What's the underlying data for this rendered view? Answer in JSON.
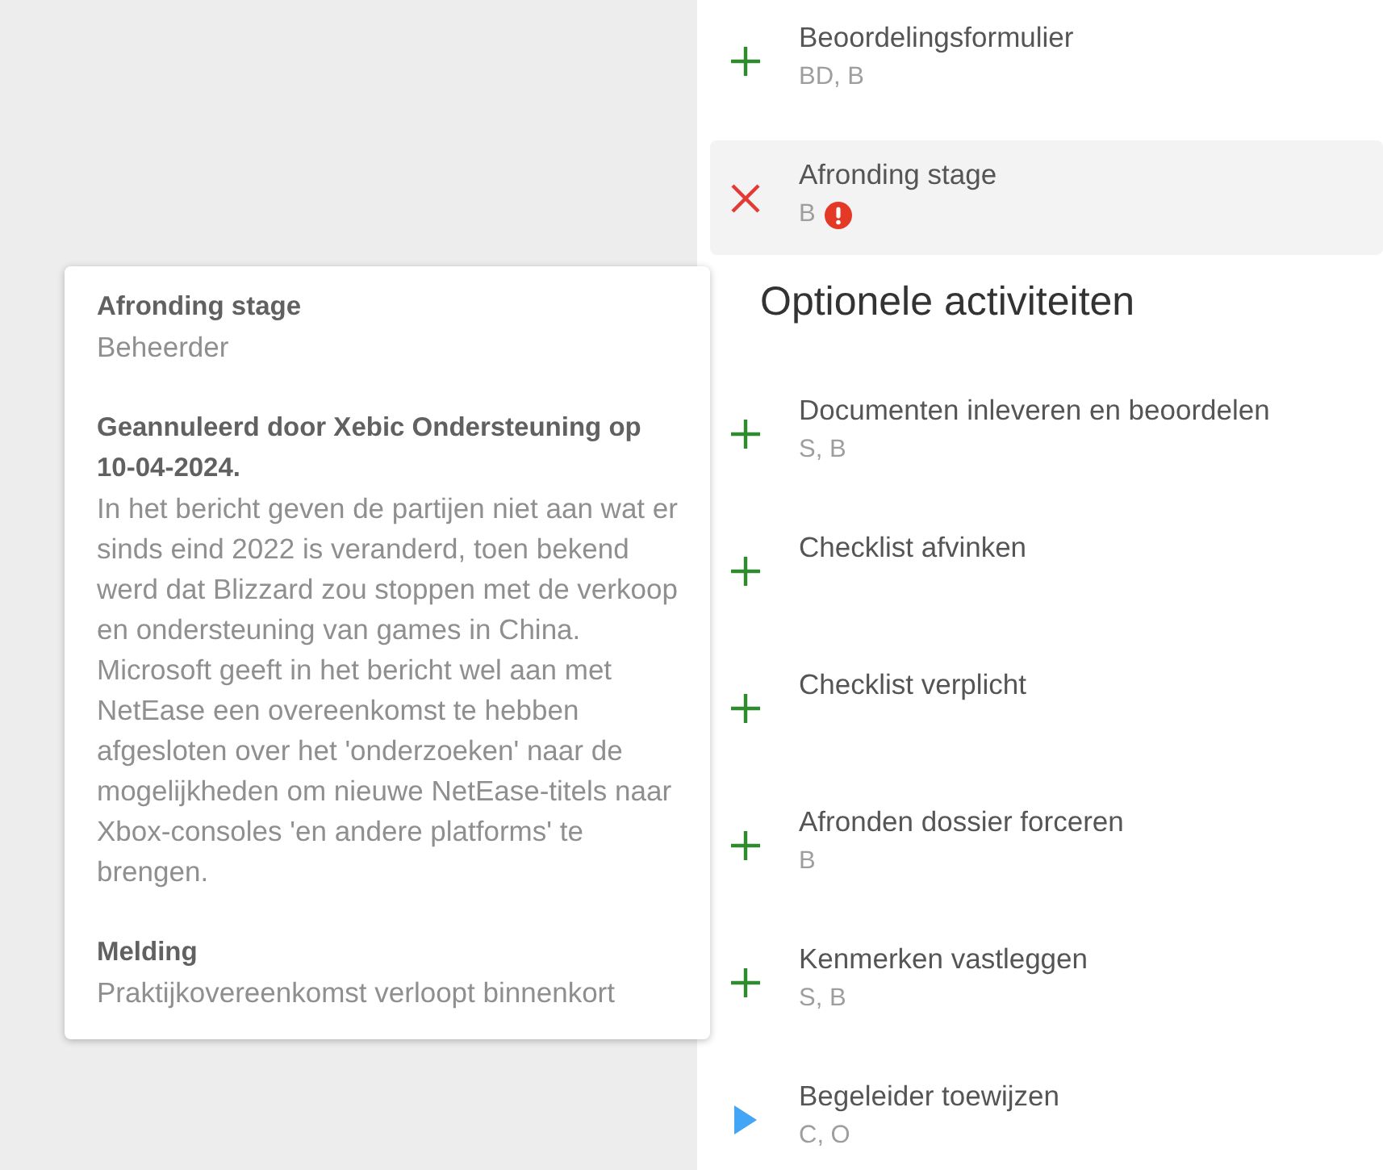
{
  "activities": [
    {
      "kind": "add",
      "title": "Beoordelingsformulier",
      "roles": "BD, B",
      "selected": false,
      "alert": false
    },
    {
      "kind": "cancelled",
      "title": "Afronding stage",
      "roles": "B",
      "selected": true,
      "alert": true
    }
  ],
  "optional_section": {
    "heading": "Optionele activiteiten",
    "activities": [
      {
        "kind": "add",
        "title": "Documenten inleveren en beoordelen",
        "roles": "S, B",
        "selected": false,
        "alert": false
      },
      {
        "kind": "add",
        "title": "Checklist afvinken",
        "selected": false,
        "alert": false
      },
      {
        "kind": "add",
        "title": "Checklist verplicht",
        "selected": false,
        "alert": false
      },
      {
        "kind": "add",
        "title": "Afronden dossier forceren",
        "roles": "B",
        "selected": false,
        "alert": false
      },
      {
        "kind": "add",
        "title": "Kenmerken vastleggen",
        "roles": "S, B",
        "selected": false,
        "alert": false
      },
      {
        "kind": "start",
        "title": "Begeleider toewijzen",
        "roles": "C, O",
        "selected": false,
        "alert": false
      }
    ]
  },
  "tooltip": {
    "title": "Afronding stage",
    "subtitle": "Beheerder",
    "sections": [
      {
        "heading": "Geannuleerd door Xebic Ondersteuning op 10-04-2024.",
        "text": "In het bericht geven de partijen niet aan wat er sinds eind 2022 is veranderd, toen bekend werd dat Blizzard zou stoppen met de verkoop en ondersteuning van games in China. Microsoft geeft in het bericht wel aan met NetEase een overeenkomst te hebben afgesloten over het 'onderzoeken' naar de mogelijkheden om nieuwe NetEase-titels naar Xbox-consoles 'en andere platforms' te brengen."
      },
      {
        "heading": "Melding",
        "text": "Praktijkovereenkomst verloopt binnenkort"
      }
    ]
  }
}
